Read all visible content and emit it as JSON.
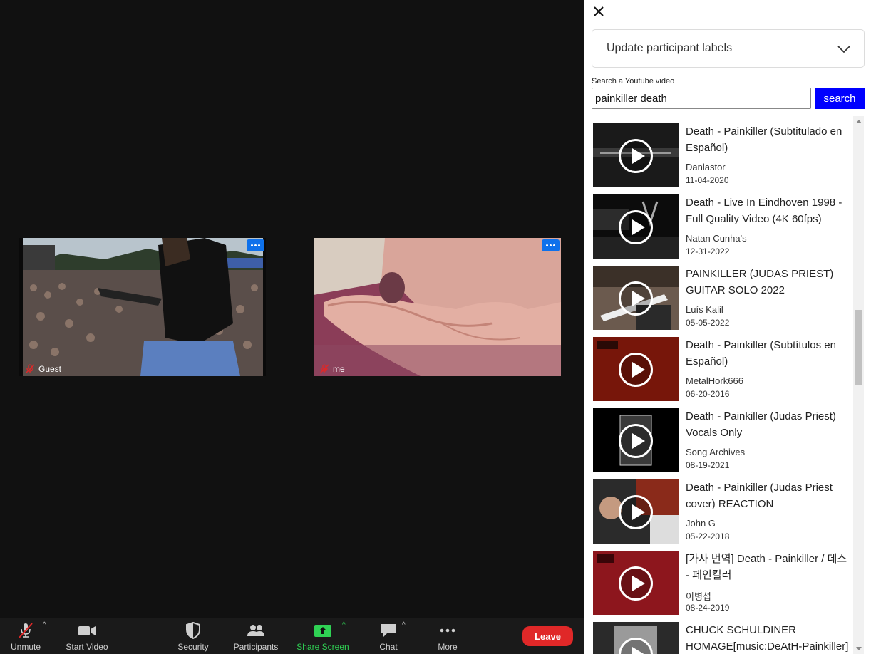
{
  "meeting": {
    "tiles": [
      {
        "name": "Guest",
        "muted": true
      },
      {
        "name": "me",
        "muted": true
      }
    ]
  },
  "toolbar": {
    "unmute": "Unmute",
    "start_video": "Start Video",
    "security": "Security",
    "participants": "Participants",
    "share_screen": "Share Screen",
    "chat": "Chat",
    "more": "More",
    "leave": "Leave"
  },
  "panel": {
    "labels_dropdown": "Update participant labels",
    "search_label": "Search a Youtube video",
    "search_value": "painkiller death",
    "search_button": "search",
    "results": [
      {
        "title": "Death - Painkiller (Subtitulado en Español)",
        "channel": "Danlastor",
        "date": "11-04-2020"
      },
      {
        "title": "Death - Live In Eindhoven 1998 - Full Quality Video (4K 60fps)",
        "channel": "Natan Cunha's",
        "date": "12-31-2022"
      },
      {
        "title": "PAINKILLER (JUDAS PRIEST) GUITAR SOLO 2022",
        "channel": "Luís Kalil",
        "date": "05-05-2022"
      },
      {
        "title": "Death - Painkiller (Subtítulos en Español)",
        "channel": "MetalHork666",
        "date": "06-20-2016"
      },
      {
        "title": "Death - Painkiller (Judas Priest) Vocals Only",
        "channel": "Song Archives",
        "date": "08-19-2021"
      },
      {
        "title": "Death - Painkiller (Judas Priest cover) REACTION",
        "channel": "John G",
        "date": "05-22-2018"
      },
      {
        "title": "[가사 번역] Death - Painkiller / 데스 - 페인킬러",
        "channel": "이병섭",
        "date": "08-24-2019"
      },
      {
        "title": "CHUCK SCHULDINER HOMAGE[music:DeAtH-Painkiller]",
        "channel": "",
        "date": ""
      }
    ]
  },
  "colors": {
    "accent_blue": "#0e71eb",
    "search_button": "#0000ff",
    "leave_red": "#e02828",
    "share_green": "#2fd254"
  }
}
